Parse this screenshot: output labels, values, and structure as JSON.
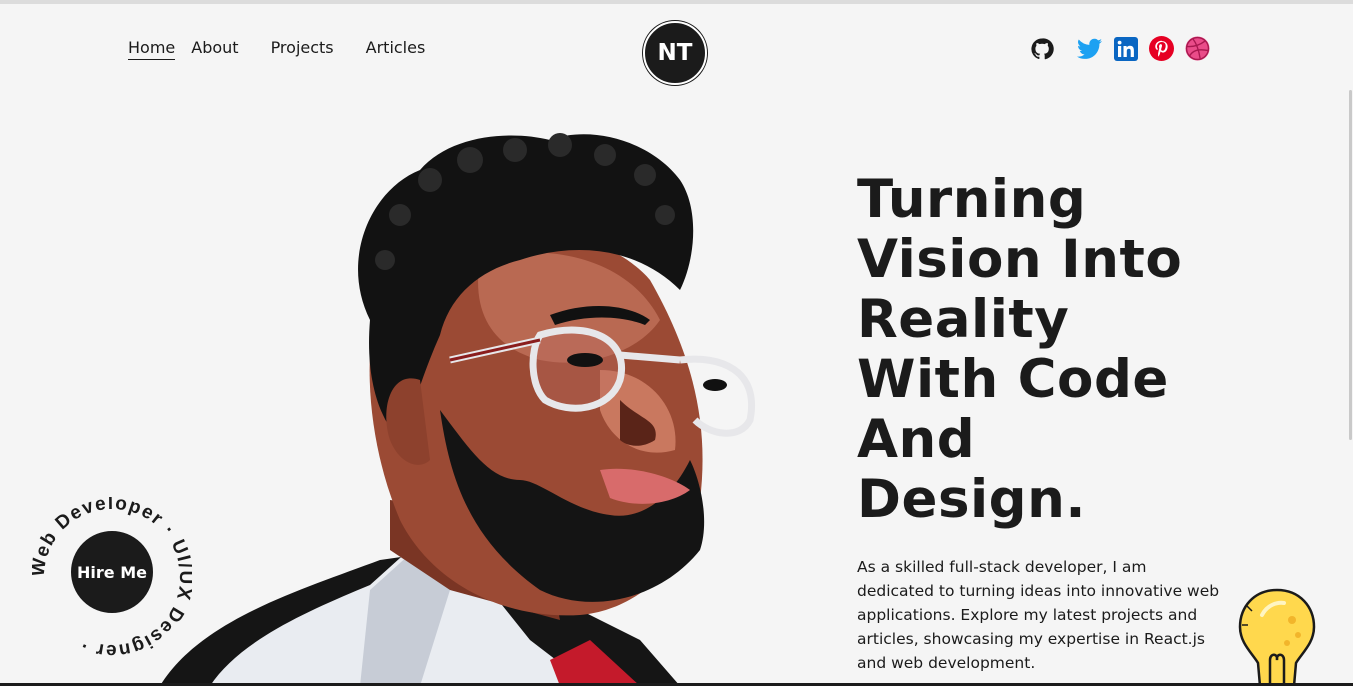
{
  "nav": {
    "items": [
      {
        "label": "Home",
        "active": true
      },
      {
        "label": "About",
        "active": false
      },
      {
        "label": "Projects",
        "active": false
      },
      {
        "label": "Articles",
        "active": false
      }
    ]
  },
  "logo": {
    "initials": "NT"
  },
  "social": [
    {
      "icon": "github-icon",
      "color": "#1b1b1b"
    },
    {
      "icon": "twitter-icon",
      "color": "#1da1f2"
    },
    {
      "icon": "linkedin-icon",
      "color": "#0a66c2"
    },
    {
      "icon": "pinterest-icon",
      "color": "#e60023"
    },
    {
      "icon": "dribbble-icon",
      "color": "#ea4c89"
    }
  ],
  "hero": {
    "headline_lines": [
      "Turning",
      "Vision Into",
      "Reality",
      "With Code",
      "And",
      "Design."
    ],
    "description": "As a skilled full-stack developer, I am dedicated to turning ideas into innovative web applications. Explore my latest projects and articles, showcasing my expertise in React.js and web development."
  },
  "hire": {
    "label": "Hire Me",
    "ring_text": "Web Developer · UI/UX Designer ·"
  },
  "colors": {
    "background": "#f5f5f5",
    "dark": "#1b1b1b"
  }
}
